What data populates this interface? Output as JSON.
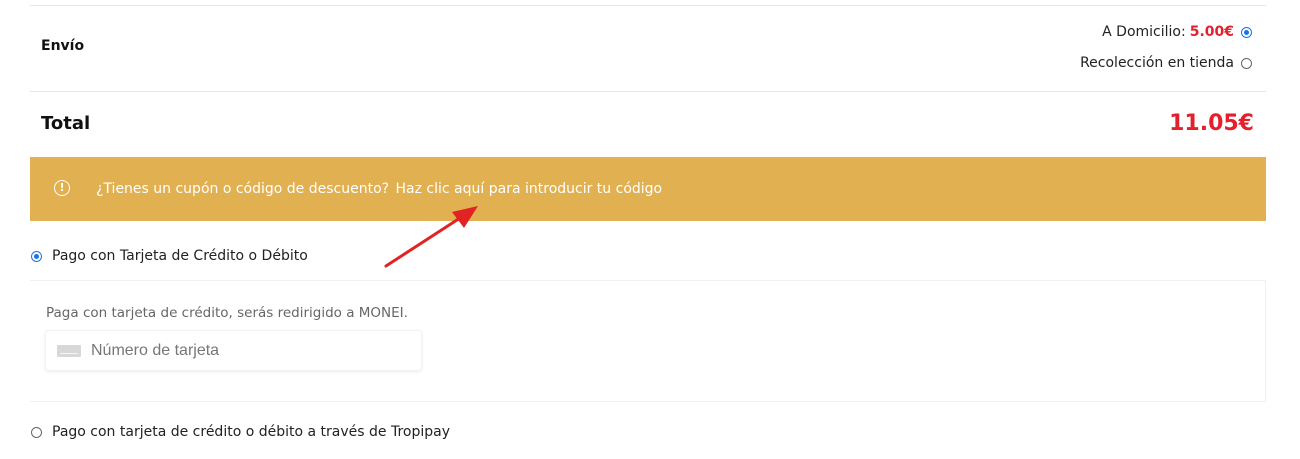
{
  "shipping": {
    "label": "Envío",
    "options": [
      {
        "label": "A Domicilio:",
        "price": "5.00€",
        "selected": true
      },
      {
        "label": "Recolección en tienda",
        "selected": false
      }
    ]
  },
  "total": {
    "label": "Total",
    "value": "11.05€"
  },
  "coupon": {
    "icon": "info-circle-icon",
    "question": "¿Tienes un cupón o código de descuento?",
    "link": "Haz clic aquí para introducir tu código",
    "background_color": "#e0b051"
  },
  "payment": {
    "options": [
      {
        "label": "Pago con Tarjeta de Crédito o Débito",
        "selected": true
      },
      {
        "label": "Pago con tarjeta de crédito o débito a través de Tropipay",
        "selected": false
      }
    ],
    "card_panel": {
      "description": "Paga con tarjeta de crédito, serás redirigido a MONEI.",
      "card_number_placeholder": "Número de tarjeta"
    }
  },
  "colors": {
    "price_accent": "#e5202d",
    "radio_accent": "#1a73e8",
    "annotation_arrow": "#e02424"
  }
}
